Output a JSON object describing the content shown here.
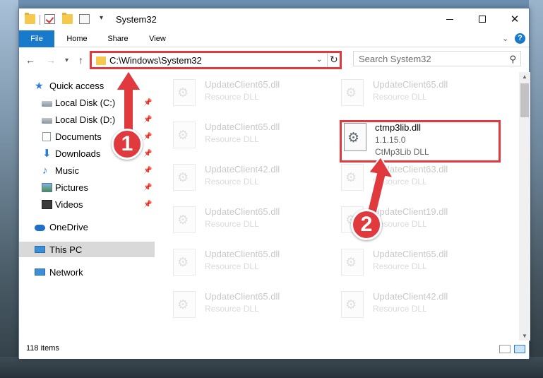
{
  "window": {
    "title": "System32",
    "controls": {
      "minimize": "—",
      "maximize": "□",
      "close": "✕"
    }
  },
  "ribbon": {
    "tabs": [
      "File",
      "Home",
      "Share",
      "View"
    ],
    "help": "?"
  },
  "nav": {
    "address": "C:\\Windows\\System32",
    "search_placeholder": "Search System32"
  },
  "sidebar": {
    "items": [
      {
        "label": "Quick access",
        "icon": "star-icon"
      },
      {
        "label": "Local Disk (C:)",
        "icon": "drive-icon",
        "pinned": true
      },
      {
        "label": "Local Disk (D:)",
        "icon": "drive-icon",
        "pinned": true
      },
      {
        "label": "Documents",
        "icon": "documents-icon",
        "pinned": true
      },
      {
        "label": "Downloads",
        "icon": "download-icon",
        "pinned": true
      },
      {
        "label": "Music",
        "icon": "music-icon",
        "pinned": true
      },
      {
        "label": "Pictures",
        "icon": "pictures-icon",
        "pinned": true
      },
      {
        "label": "Videos",
        "icon": "videos-icon",
        "pinned": true
      },
      {
        "label": "OneDrive",
        "icon": "cloud-icon"
      },
      {
        "label": "This PC",
        "icon": "computer-icon",
        "selected": true
      },
      {
        "label": "Network",
        "icon": "network-icon"
      }
    ]
  },
  "files": {
    "items": [
      {
        "name": "UpdateClient65.dll",
        "desc": "Resource DLL"
      },
      {
        "name": "UpdateClient65.dll",
        "desc": "Resource DLL"
      },
      {
        "name": "UpdateClient65.dll",
        "desc": "Resource DLL"
      },
      {
        "name": "UpdateClient42.dll",
        "desc": "Resource DLL"
      },
      {
        "name": "UpdateClient63.dll",
        "desc": "Resource DLL"
      },
      {
        "name": "UpdateClient65.dll",
        "desc": "Resource DLL"
      },
      {
        "name": "UpdateClient19.dll",
        "desc": "Resource DLL"
      },
      {
        "name": "UpdateClient65.dll",
        "desc": "Resource DLL"
      },
      {
        "name": "UpdateClient65.dll",
        "desc": "Resource DLL"
      },
      {
        "name": "UpdateClient65.dll",
        "desc": "Resource DLL"
      },
      {
        "name": "UpdateClient42.dll",
        "desc": "Resource DLL"
      }
    ],
    "highlighted": {
      "name": "ctmp3lib.dll",
      "version": "1.1.15.0",
      "desc": "CtMp3Lib DLL"
    }
  },
  "status": {
    "items_count": "118 items"
  },
  "annotations": {
    "step1": "1",
    "step2": "2"
  },
  "colors": {
    "accent": "#1979ca",
    "highlight": "#e0393e"
  }
}
